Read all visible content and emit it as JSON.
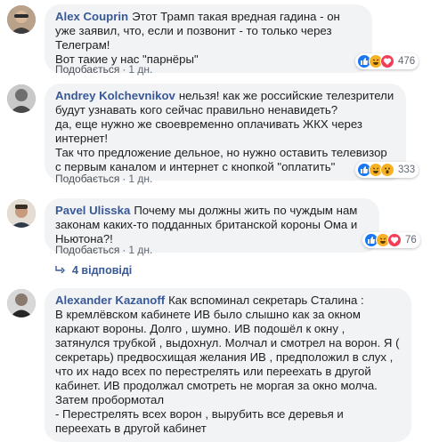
{
  "comments": [
    {
      "author": "Alex Couprin",
      "text": "Этот Трамп такая вредная гадина - он уже заявил, что, если и позвонит - то только через Телеграм!\nВот такие у нас \"парнёры\"",
      "like_label": "Подобається",
      "time": "1 дн.",
      "reaction_count": "476",
      "reactions": [
        "like-icon",
        "haha-icon",
        "love-icon"
      ]
    },
    {
      "author": "Andrey Kolchevnikov",
      "text": "нельзя! как же российские телезрители будут узнавать кого сейчас правильно ненавидеть?\nда, еще нужно же своевременно оплачивать ЖКХ через интернет!\nТак что предложение дельное, но нужно оставить телевизор с первым каналом и интернет с кнопкой \"оплатить\"",
      "like_label": "Подобається",
      "time": "1 дн.",
      "reaction_count": "333",
      "reactions": [
        "like-icon",
        "haha-icon",
        "wow-icon"
      ]
    },
    {
      "author": "Pavel Ulisska",
      "text": "Почему мы должны жить по чуждым нам законам каких-то подданных британской короны Ома и Ньютона?!",
      "like_label": "Подобається",
      "time": "1 дн.",
      "reaction_count": "76",
      "reactions": [
        "like-icon",
        "haha-icon",
        "love-icon"
      ]
    },
    {
      "author": "Alexander Kazanoff",
      "text": "Как вспоминал секретарь Сталина :\nВ кремлёвском кабинете ИВ было слышно как за окном каркают вороны. Долго , шумно. ИВ подошёл к окну , затянулся трубкой , выдохнул. Молчал и смотрел на ворон. Я ( секретарь) предвосхищая желания ИВ , предположил в слух , что их надо всех по перестрелять или переехать в другой кабинет. ИВ продолжал смотреть не моргая за окно молча. Затем пробормотал\n- Перестрелять всех ворон , вырубить все деревья и переехать в другой кабинет"
    }
  ],
  "replies_label": "4 відповіді",
  "colors": {
    "author": "#385898",
    "bubble": "#f2f3f5",
    "like": "#1877f2",
    "haha": "#f7b125",
    "love": "#f33e58"
  }
}
